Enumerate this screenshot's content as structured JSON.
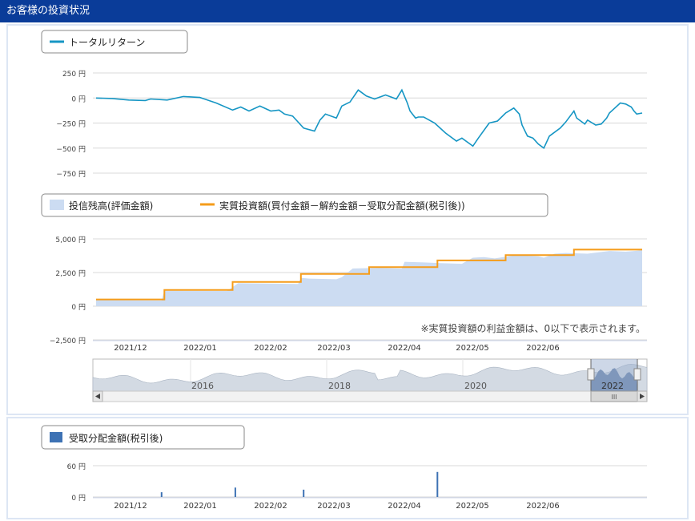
{
  "header": {
    "title": "お客様の投資状況"
  },
  "colors": {
    "header_bg": "#0a3c99",
    "return_line": "#1696c4",
    "balance_fill": "#ccdcf2",
    "investment_line": "#f59c1a",
    "distribution_bar": "#3d72b4",
    "navigator_fill": "#c7cfd9"
  },
  "return_panel": {
    "legend": {
      "series": "トータルリターン"
    }
  },
  "balance_panel": {
    "legend": {
      "balance": "投信残高(評価金額)",
      "investment": "実質投資額(買付金額－解約金額－受取分配金額(税引後))"
    },
    "note": "※実質投資額の利益金額は、0以下で表示されます。"
  },
  "navigator": {
    "year_labels": [
      "2016",
      "2018",
      "2020",
      "2022"
    ],
    "scroll_left_icon": "arrow-left-icon",
    "scroll_right_icon": "arrow-right-icon",
    "scroll_thumb_icon": "grip-icon",
    "scroll_thumb_label": "III"
  },
  "distribution_panel": {
    "legend": {
      "series": "受取分配金額(税引後)"
    }
  },
  "chart_data": [
    {
      "type": "line",
      "series": [
        {
          "name": "トータルリターン",
          "x": [
            0,
            0.03,
            0.06,
            0.09,
            0.1,
            0.13,
            0.16,
            0.19,
            0.22,
            0.25,
            0.265,
            0.28,
            0.3,
            0.32,
            0.335,
            0.345,
            0.36,
            0.38,
            0.4,
            0.41,
            0.42,
            0.44,
            0.45,
            0.465,
            0.48,
            0.495,
            0.51,
            0.53,
            0.55,
            0.56,
            0.57,
            0.575,
            0.585,
            0.59,
            0.6,
            0.62,
            0.64,
            0.66,
            0.67,
            0.69,
            0.7,
            0.72,
            0.735,
            0.75,
            0.765,
            0.775,
            0.78,
            0.79,
            0.8,
            0.81,
            0.82,
            0.83,
            0.85,
            0.86,
            0.875,
            0.88,
            0.895,
            0.9,
            0.915,
            0.925,
            0.935,
            0.94,
            0.96,
            0.97,
            0.98,
            0.985,
            0.99,
            1.0
          ],
          "values": [
            0,
            -5,
            -20,
            -25,
            -10,
            -20,
            15,
            5,
            -50,
            -120,
            -90,
            -130,
            -80,
            -130,
            -120,
            -160,
            -180,
            -300,
            -330,
            -220,
            -160,
            -200,
            -80,
            -40,
            80,
            20,
            -10,
            30,
            -10,
            80,
            -50,
            -130,
            -200,
            -190,
            -190,
            -250,
            -350,
            -430,
            -400,
            -480,
            -400,
            -250,
            -230,
            -150,
            -100,
            -160,
            -270,
            -380,
            -400,
            -460,
            -500,
            -380,
            -300,
            -240,
            -130,
            -200,
            -260,
            -220,
            -270,
            -260,
            -200,
            -150,
            -50,
            -60,
            -90,
            -130,
            -160,
            -150
          ]
        }
      ],
      "ylim": [
        -750,
        250
      ],
      "yticks": [
        "250 円",
        "0 円",
        "−250 円",
        "−500 円",
        "−750 円"
      ]
    },
    {
      "type": "area",
      "x_labels": [
        "2021/12",
        "2022/01",
        "2022/02",
        "2022/03",
        "2022/04",
        "2022/05",
        "2022/06"
      ],
      "series": [
        {
          "name": "投信残高(評価金額)",
          "type": "area",
          "x": [
            0,
            0.12,
            0.125,
            0.24,
            0.26,
            0.37,
            0.375,
            0.39,
            0.44,
            0.45,
            0.47,
            0.52,
            0.56,
            0.565,
            0.6,
            0.63,
            0.67,
            0.69,
            0.71,
            0.73,
            0.77,
            0.81,
            0.82,
            0.84,
            0.86,
            0.9,
            0.94,
            0.97,
            1.0
          ],
          "values": [
            450,
            420,
            1150,
            1130,
            1700,
            1650,
            2100,
            2050,
            2000,
            2150,
            2800,
            2850,
            2800,
            3300,
            3250,
            3200,
            3150,
            3600,
            3650,
            3550,
            3800,
            3700,
            3600,
            3900,
            3950,
            3900,
            4100,
            4050,
            4150
          ]
        },
        {
          "name": "実質投資額(買付金額－解約金額－受取分配金額(税引後))",
          "type": "line",
          "x": [
            0,
            0.125,
            0.25,
            0.375,
            0.5,
            0.625,
            0.75,
            0.875,
            1.0
          ],
          "values": [
            500,
            1200,
            1800,
            2400,
            2900,
            3400,
            3800,
            4200,
            4200
          ],
          "step": true
        }
      ],
      "ylim": [
        -2500,
        5000
      ],
      "yticks": [
        "5,000 円",
        "2,500 円",
        "0 円",
        "−2,500 円"
      ]
    },
    {
      "type": "bar",
      "x_labels": [
        "2021/12",
        "2022/01",
        "2022/02",
        "2022/03",
        "2022/04",
        "2022/05",
        "2022/06"
      ],
      "series": [
        {
          "name": "受取分配金額(税引後)",
          "x": [
            0.12,
            0.255,
            0.38,
            0.625
          ],
          "values": [
            9,
            18,
            14,
            48
          ]
        }
      ],
      "ylim": [
        0,
        60
      ],
      "yticks": [
        "60 円",
        "0 円"
      ]
    }
  ]
}
